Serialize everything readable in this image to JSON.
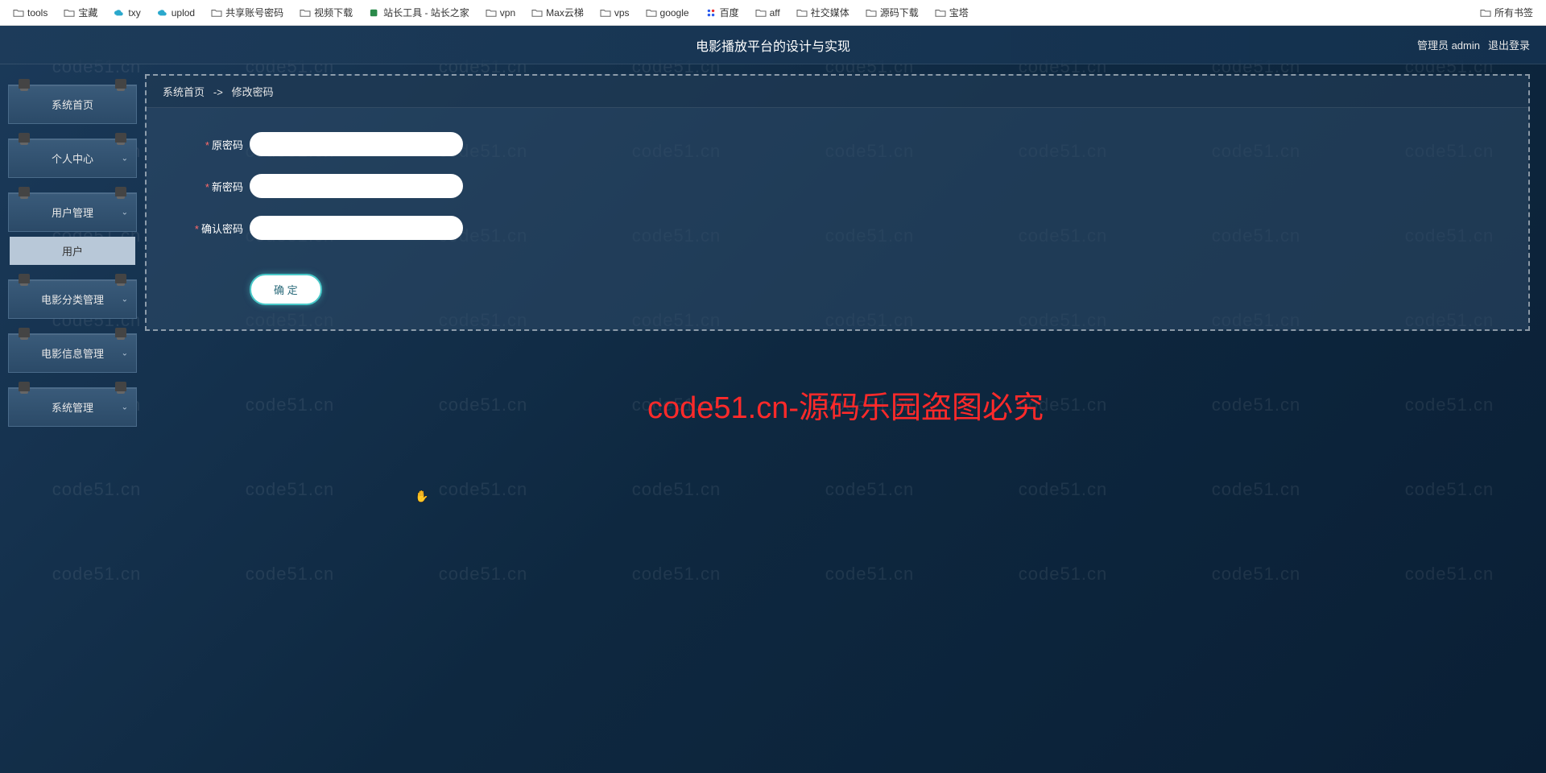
{
  "bookmarks": {
    "items": [
      {
        "label": "tools",
        "icon": "folder"
      },
      {
        "label": "宝藏",
        "icon": "folder"
      },
      {
        "label": "txy",
        "icon": "cloud"
      },
      {
        "label": "uplod",
        "icon": "cloud"
      },
      {
        "label": "共享账号密码",
        "icon": "folder"
      },
      {
        "label": "视频下载",
        "icon": "folder"
      },
      {
        "label": "站长工具 - 站长之家",
        "icon": "tool"
      },
      {
        "label": "vpn",
        "icon": "folder"
      },
      {
        "label": "Max云梯",
        "icon": "folder"
      },
      {
        "label": "vps",
        "icon": "folder"
      },
      {
        "label": "google",
        "icon": "folder"
      },
      {
        "label": "百度",
        "icon": "baidu"
      },
      {
        "label": "aff",
        "icon": "folder"
      },
      {
        "label": "社交媒体",
        "icon": "folder"
      },
      {
        "label": "源码下载",
        "icon": "folder"
      },
      {
        "label": "宝塔",
        "icon": "folder"
      }
    ],
    "all_bookmarks": "所有书签"
  },
  "header": {
    "title": "电影播放平台的设计与实现",
    "role_label": "管理员 admin",
    "logout": "退出登录"
  },
  "sidebar": {
    "items": [
      {
        "label": "系统首页",
        "expandable": false
      },
      {
        "label": "个人中心",
        "expandable": true
      },
      {
        "label": "用户管理",
        "expandable": true,
        "expanded": true
      },
      {
        "label": "电影分类管理",
        "expandable": true
      },
      {
        "label": "电影信息管理",
        "expandable": true
      },
      {
        "label": "系统管理",
        "expandable": true
      }
    ],
    "submenu_user": "用户"
  },
  "breadcrumb": {
    "home": "系统首页",
    "separator": "->",
    "current": "修改密码"
  },
  "form": {
    "old_password_label": "原密码",
    "new_password_label": "新密码",
    "confirm_password_label": "确认密码",
    "old_password_value": "",
    "new_password_value": "",
    "confirm_password_value": "",
    "submit_label": "确 定"
  },
  "watermark": {
    "text": "code51.cn",
    "red_text": "code51.cn-源码乐园盗图必究"
  }
}
